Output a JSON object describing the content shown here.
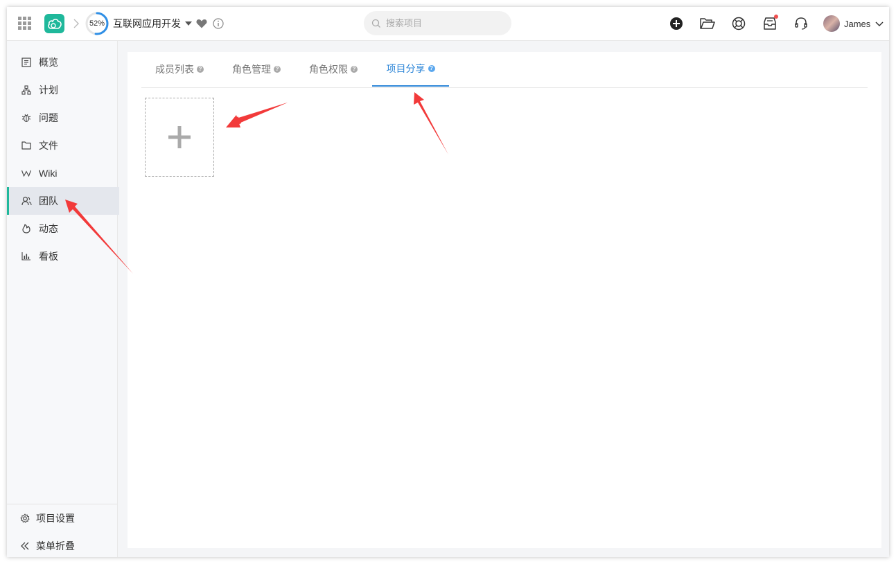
{
  "header": {
    "progress_percent": 52,
    "progress_text": "52%",
    "project_name": "互联网应用开发",
    "search_placeholder": "搜索项目",
    "user_name": "James"
  },
  "sidebar": {
    "items": [
      {
        "label": "概览",
        "icon": "overview-icon"
      },
      {
        "label": "计划",
        "icon": "plan-icon"
      },
      {
        "label": "问题",
        "icon": "bug-icon"
      },
      {
        "label": "文件",
        "icon": "folder-icon"
      },
      {
        "label": "Wiki",
        "icon": "wiki-icon"
      },
      {
        "label": "团队",
        "icon": "team-icon"
      },
      {
        "label": "动态",
        "icon": "fire-icon"
      },
      {
        "label": "看板",
        "icon": "chart-icon"
      }
    ],
    "active_index": 5,
    "settings_label": "项目设置",
    "collapse_label": "菜单折叠"
  },
  "tabs": [
    {
      "label": "成员列表"
    },
    {
      "label": "角色管理"
    },
    {
      "label": "角色权限"
    },
    {
      "label": "项目分享"
    }
  ],
  "colors": {
    "accent": "#1fb89b",
    "tab_active": "#2f87d8",
    "annotation_arrow": "#f23a3a"
  }
}
